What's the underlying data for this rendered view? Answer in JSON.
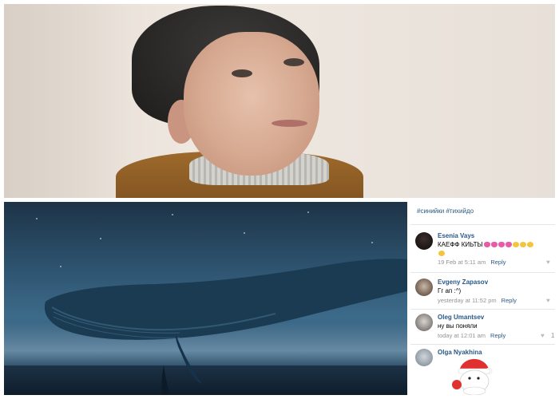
{
  "photos": {
    "top_icon": "portrait-photo",
    "bottom_icon": "blue-whale-photo"
  },
  "post": {
    "hashtags": "#синийки #тихийдо"
  },
  "comments": [
    {
      "author": "Esenia Vays",
      "text": "КАЕФФ КИЬТЫ",
      "text_emoji": "pink-hearts and crying-faces",
      "date": "19 Feb at 5:11 am",
      "reply": "Reply",
      "likes": ""
    },
    {
      "author": "Evgeny Zapasov",
      "text": "Гг ап :^)",
      "date": "yesterday at 11:52 pm",
      "reply": "Reply",
      "likes": ""
    },
    {
      "author": "Oleg Umantsev",
      "text": "ну вы поняли",
      "date": "today at 12:01 am",
      "reply": "Reply",
      "likes": "1"
    },
    {
      "author": "Olga Nyakhina",
      "text": "",
      "date": "",
      "reply": "",
      "likes": "",
      "sticker": "santa-sticker"
    }
  ],
  "colors": {
    "link": "#2a5885",
    "meta": "#939393",
    "divider": "#e4e7ea",
    "whale_sky": "#2e5470"
  }
}
